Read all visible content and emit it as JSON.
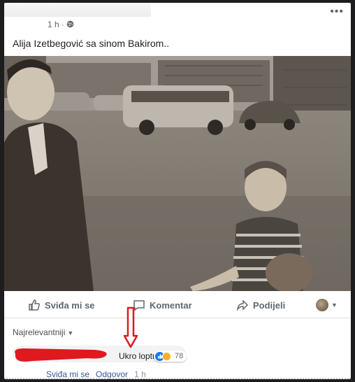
{
  "post": {
    "timestamp": "1 h",
    "separator": "·",
    "privacy_icon": "globe-icon",
    "more_icon": "more-dots-icon",
    "text": "Alija Izetbegović sa sinom Bakirom.."
  },
  "actions": {
    "like_label": "Sviđa mi se",
    "comment_label": "Komentar",
    "share_label": "Podijeli"
  },
  "comments": {
    "sort_label": "Najrelevantniji",
    "items": [
      {
        "text": "Ukro loptu.",
        "reaction_count": "78",
        "reactions": [
          "like-icon",
          "haha-icon"
        ],
        "like_link": "Sviđa mi se",
        "reply_link": "Odgovor",
        "time": "1 h"
      }
    ]
  },
  "colors": {
    "brand_blue": "#1877f2",
    "link_blue": "#385898",
    "muted_text": "#606770",
    "annotation_red": "#e0191f"
  }
}
